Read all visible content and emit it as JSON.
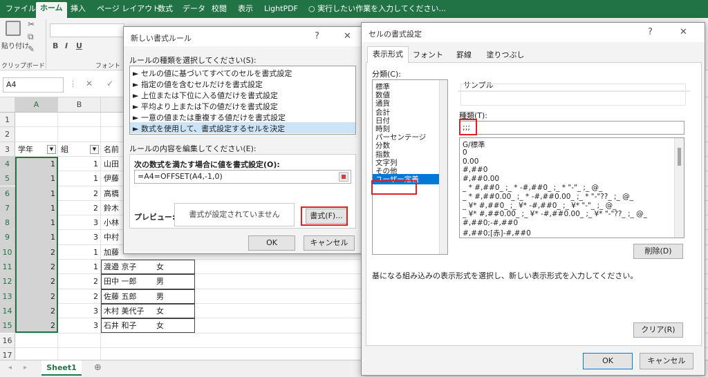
{
  "ribbon": {
    "tabs": [
      "ファイル",
      "ホーム",
      "挿入",
      "ページ レイアウト",
      "数式",
      "データ",
      "校閲",
      "表示",
      "LightPDF"
    ],
    "tell_me": "実行したい作業を入力してください...",
    "paste_label": "貼り付け",
    "clipboard_label": "クリップボード",
    "font_label": "フォント",
    "bold": "B",
    "italic": "I",
    "underline": "U"
  },
  "formula_bar": {
    "name_box": "A4",
    "cancel_icon": "✕",
    "enter_icon": "✓"
  },
  "sheet": {
    "columns": [
      "A",
      "B"
    ],
    "rows": [
      "1",
      "2",
      "3",
      "4",
      "5",
      "6",
      "7",
      "8",
      "9",
      "10",
      "11",
      "12",
      "13",
      "14",
      "15",
      "16",
      "17"
    ],
    "headers": [
      "学年",
      "組",
      "名前"
    ],
    "data": [
      {
        "grade": "1",
        "class": "1",
        "name": "山田",
        "sex": ""
      },
      {
        "grade": "1",
        "class": "1",
        "name": "伊藤",
        "sex": ""
      },
      {
        "grade": "1",
        "class": "2",
        "name": "高橋",
        "sex": ""
      },
      {
        "grade": "1",
        "class": "2",
        "name": "鈴木",
        "sex": ""
      },
      {
        "grade": "1",
        "class": "3",
        "name": "小林",
        "sex": ""
      },
      {
        "grade": "1",
        "class": "3",
        "name": "中村",
        "sex": ""
      },
      {
        "grade": "2",
        "class": "1",
        "name": "加藤",
        "sex": ""
      },
      {
        "grade": "2",
        "class": "1",
        "name": "渡邉 京子",
        "sex": "女"
      },
      {
        "grade": "2",
        "class": "2",
        "name": "田中 一郎",
        "sex": "男"
      },
      {
        "grade": "2",
        "class": "2",
        "name": "佐藤 五郎",
        "sex": "男"
      },
      {
        "grade": "2",
        "class": "3",
        "name": "木村 美代子",
        "sex": "女"
      },
      {
        "grade": "2",
        "class": "3",
        "name": "石井 和子",
        "sex": "女"
      }
    ],
    "sheet_tab": "Sheet1",
    "add_sheet": "⊕"
  },
  "rule_dialog": {
    "title": "新しい書式ルール",
    "help": "?",
    "close": "✕",
    "select_type_label": "ルールの種類を選択してください(S):",
    "rule_types": [
      "► セルの値に基づいてすべてのセルを書式設定",
      "► 指定の値を含むセルだけを書式設定",
      "► 上位または下位に入る値だけを書式設定",
      "► 平均より上または下の値だけを書式設定",
      "► 一意の値または重複する値だけを書式設定",
      "► 数式を使用して、書式設定するセルを決定"
    ],
    "edit_label": "ルールの内容を編集してください(E):",
    "formula_label": "次の数式を満たす場合に値を書式設定(O):",
    "formula_value": "=A4=OFFSET(A4,-1,0)",
    "preview_label": "プレビュー:",
    "preview_text": "書式が設定されていません",
    "format_button": "書式(F)...",
    "ok": "OK",
    "cancel": "キャンセル"
  },
  "cell_dialog": {
    "title": "セルの書式設定",
    "help": "?",
    "close": "✕",
    "tabs": [
      "表示形式",
      "フォント",
      "罫線",
      "塗りつぶし"
    ],
    "category_label": "分類(C):",
    "categories": [
      "標準",
      "数値",
      "通貨",
      "会計",
      "日付",
      "時刻",
      "パーセンテージ",
      "分数",
      "指数",
      "文字列",
      "その他",
      "ユーザー定義"
    ],
    "sample_label": "サンプル",
    "type_label": "種類(T):",
    "type_value": ";;;",
    "formats": [
      "G/標準",
      "0",
      "0.00",
      "#,##0",
      "#,##0.00",
      "_ * #,##0_ ;_ * -#,##0_ ;_ * \"-\"_ ;_ @_",
      "_ * #,##0.00_ ;_ * -#,##0.00_ ;_ * \"-\"??_ ;_ @_",
      "_ ¥* #,##0_ ;_ ¥* -#,##0_ ;_ ¥* \"-\"_ ;_ @_",
      "_ ¥* #,##0.00_ ;_ ¥* -#,##0.00_ ;_ ¥* \"-\"??_ ;_ @_",
      "#,##0;-#,##0",
      "#,##0;[赤]-#,##0"
    ],
    "delete_button": "削除(D)",
    "description": "基になる組み込みの表示形式を選択し、新しい表示形式を入力してください。",
    "clear_button": "クリア(R)",
    "ok": "OK",
    "cancel": "キャンセル"
  }
}
